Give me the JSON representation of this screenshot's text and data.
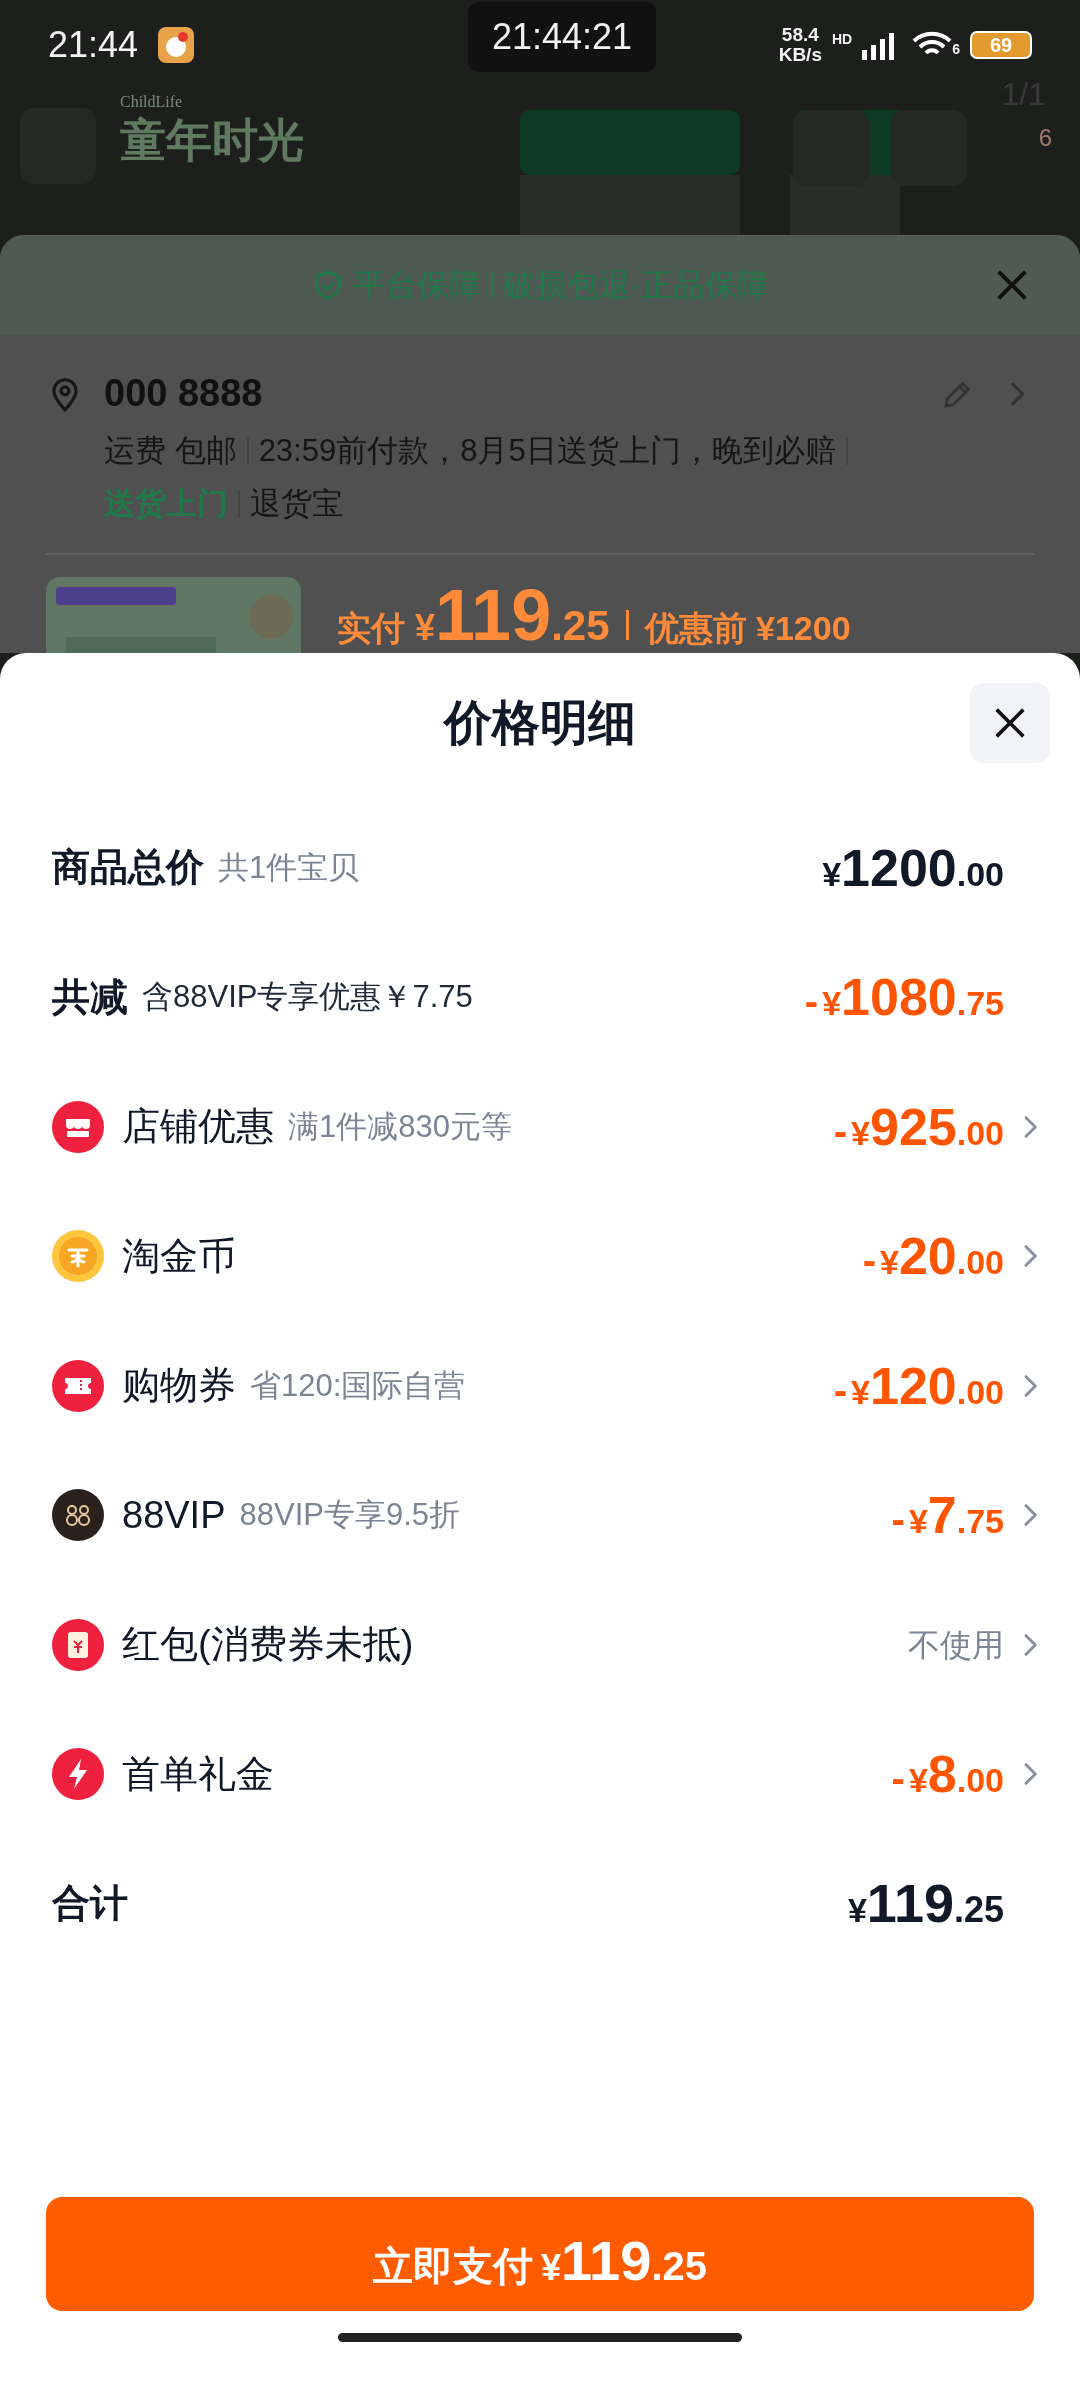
{
  "status_bar": {
    "time": "21:44",
    "clock": "21:44:21",
    "speed": "58.4",
    "speed_unit": "KB/s",
    "network": "HD",
    "wifi_badge": "6",
    "battery": "69"
  },
  "background_page": {
    "brand_en": "ChildLife",
    "brand": "童年时光",
    "counter": "1/1",
    "cart_badge": "6"
  },
  "order_sheet": {
    "guarantee": [
      "平台保障",
      "破损包退·正品保障"
    ],
    "address": "000 8888",
    "shipping": [
      "运费 包邮",
      "23:59前付款，8月5日送货上门，晚到必赔"
    ],
    "services": [
      {
        "text": "送货上门",
        "highlight": true
      },
      {
        "text": "退货宝",
        "highlight": false
      }
    ],
    "price_label": "实付",
    "price_currency": "¥",
    "price_whole": "119",
    "price_fraction": ".25",
    "original_price": "优惠前 ¥1200"
  },
  "price_detail": {
    "title": "价格明细",
    "rows": [
      {
        "kind": "plain",
        "label": "商品总价",
        "note": "共1件宝贝",
        "color": "#111827",
        "sign": "",
        "currency": "¥",
        "whole": "1200",
        "fraction": ".00",
        "chevron": false
      },
      {
        "kind": "plain",
        "label": "共减",
        "note": "含88VIP专享优惠￥7.75",
        "color": "#ff5500",
        "sign": "-",
        "currency": "¥",
        "whole": "1080",
        "fraction": ".75",
        "chevron": false
      },
      {
        "kind": "store",
        "label": "店铺优惠",
        "note": "满1件减830元等",
        "color": "#ff5500",
        "sign": "-",
        "currency": "¥",
        "whole": "925",
        "fraction": ".00",
        "chevron": true
      },
      {
        "kind": "coin",
        "label": "淘金币",
        "color": "#ff5500",
        "sign": "-",
        "currency": "¥",
        "whole": "20",
        "fraction": ".00",
        "chevron": true
      },
      {
        "kind": "coupon",
        "label": "购物券",
        "note": "省120:国际自营",
        "color": "#ff5500",
        "sign": "-",
        "currency": "¥",
        "whole": "120",
        "fraction": ".00",
        "chevron": true
      },
      {
        "kind": "vip",
        "label": "88VIP",
        "note": "88VIP专享9.5折",
        "color": "#ff5500",
        "sign": "-",
        "currency": "¥",
        "whole": "7",
        "fraction": ".75",
        "chevron": true
      },
      {
        "kind": "redpacket",
        "label": "红包(消费券未抵)",
        "color": "#7c8493",
        "text_value": "不使用",
        "chevron": true
      },
      {
        "kind": "bolt",
        "label": "首单礼金",
        "color": "#ff5500",
        "sign": "-",
        "currency": "¥",
        "whole": "8",
        "fraction": ".00",
        "chevron": true
      }
    ],
    "total": {
      "label": "合计",
      "currency": "¥",
      "whole": "119",
      "fraction": ".25"
    },
    "pay_button": {
      "label": "立即支付",
      "currency": "¥",
      "whole": "119",
      "fraction": ".25"
    }
  }
}
